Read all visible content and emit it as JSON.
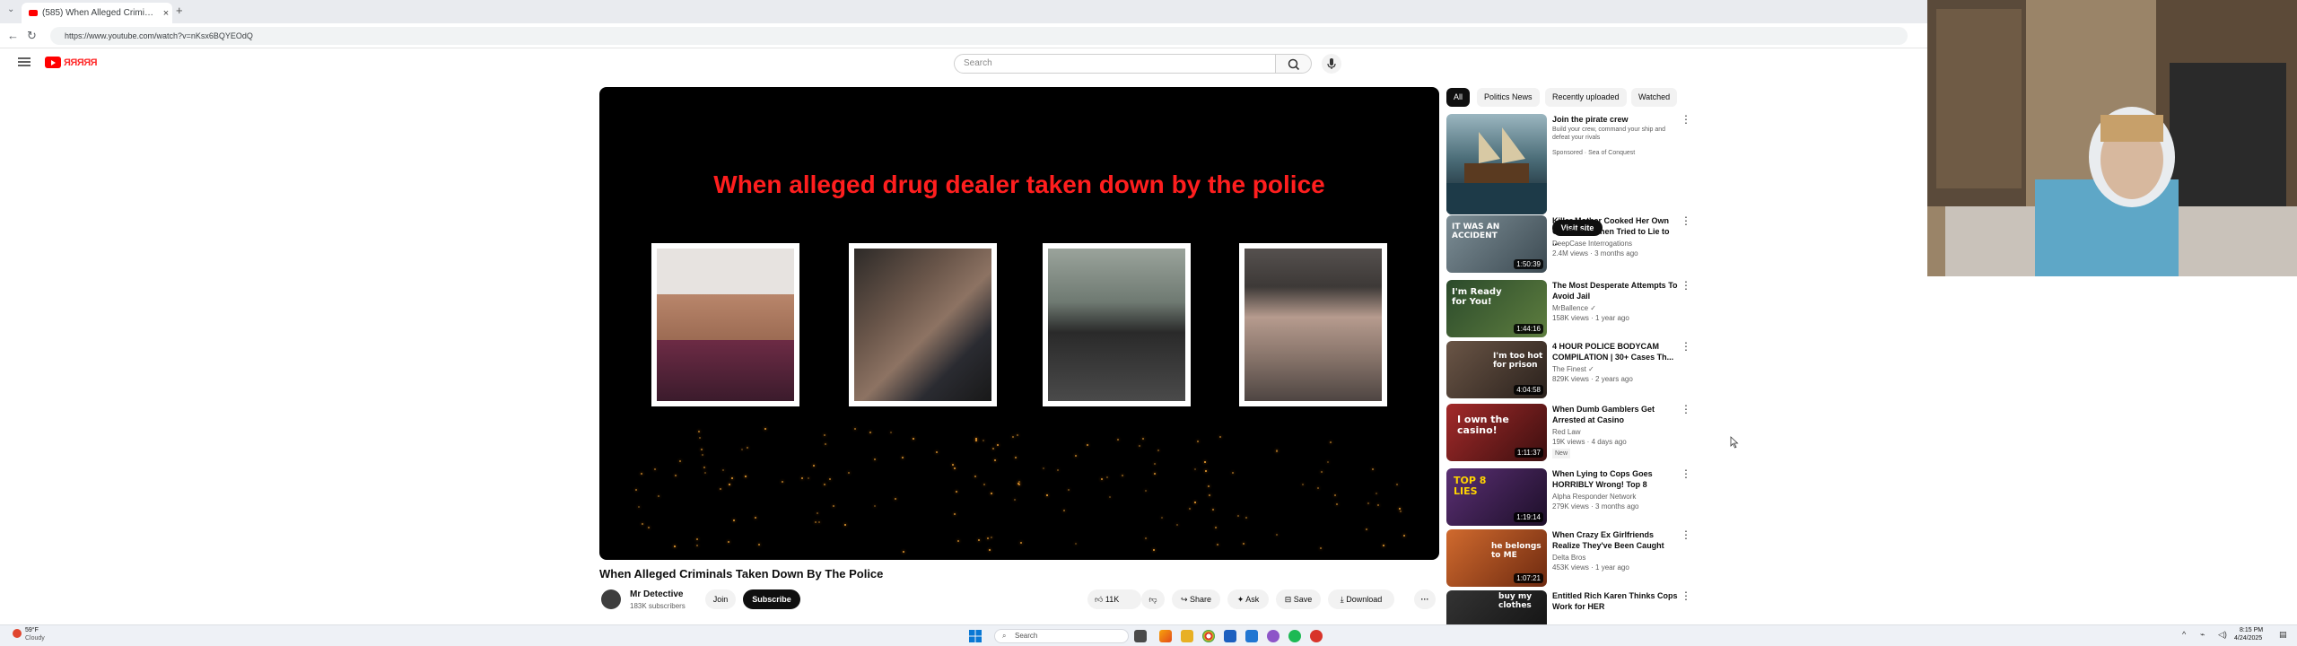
{
  "browser": {
    "tab_title": "(585) When Alleged Criminal...",
    "tab_close": "×",
    "new_tab": "+",
    "url": "https://www.youtube.com/watch?v=nKsx6BQYEOdQ"
  },
  "header": {
    "logo_text": "ЯЯЯЯЯ",
    "search_placeholder": "Search"
  },
  "video": {
    "overlay_title": "When alleged drug dealer taken down by the police",
    "title": "When Alleged Criminals Taken Down By The Police",
    "channel": "Mr Detective",
    "subscribers": "183K subscribers",
    "join_label": "Join",
    "subscribe_label": "Subscribe",
    "likes": "11K",
    "share_label": "Share",
    "ask_label": "Ask",
    "save_label": "Save",
    "download_label": "Download"
  },
  "chips": [
    "All",
    "Politics News",
    "Recently uploaded",
    "Watched"
  ],
  "recommendations": [
    {
      "title": "Join the pirate crew",
      "line1": "Build your crew, command your ship and defeat your rivals",
      "line2": "Sponsored · Sea of Conquest",
      "button": "Visit site",
      "thumb_color": "#3b5a67"
    },
    {
      "title": "Killer Mother Cooked Her Own Children -- Then Tried to Lie to ...",
      "channel": "DeepCase Interrogations",
      "stats": "2.4M views · 3 months ago",
      "duration": "1:50:39",
      "thumb_text": "IT WAS AN ACCIDENT",
      "thumb_color": "#5b6f7a"
    },
    {
      "title": "The Most Desperate Attempts To Avoid Jail",
      "channel": "MrBallence ✓",
      "stats": "158K views · 1 year ago",
      "duration": "1:44:16",
      "thumb_text": "I'm Ready for You!",
      "thumb_color": "#2f4f2f"
    },
    {
      "title": "4 HOUR POLICE BODYCAM COMPILATION | 30+ Cases Th...",
      "channel": "The Finest ✓",
      "stats": "829K views · 2 years ago",
      "duration": "4:04:58",
      "thumb_text": "I'm too hot for prison",
      "thumb_color": "#4a3c33"
    },
    {
      "title": "When Dumb Gamblers Get Arrested at Casino",
      "channel": "Red Law",
      "stats": "19K views · 4 days ago",
      "badge": "New",
      "duration": "1:11:37",
      "thumb_text": "I own the casino!",
      "thumb_color": "#7a1f1f"
    },
    {
      "title": "When Lying to Cops Goes HORRIBLY Wrong! Top 8",
      "channel": "Alpha Responder Network",
      "stats": "279K views · 3 months ago",
      "duration": "1:19:14",
      "thumb_text": "TOP 8 LIES",
      "thumb_color": "#4b2a5e"
    },
    {
      "title": "When Crazy Ex Girlfriends Realize They've Been Caught",
      "channel": "Delta Bros",
      "stats": "453K views · 1 year ago",
      "duration": "1:07:21",
      "thumb_text": "he belongs to ME",
      "thumb_color": "#b04a1d"
    },
    {
      "title": "Entitled Rich Karen Thinks Cops Work for HER",
      "channel": "",
      "stats": "",
      "duration": "",
      "thumb_text": "buy my clothes",
      "thumb_color": "#222"
    }
  ],
  "taskbar": {
    "weather_temp": "59°F",
    "weather_desc": "Cloudy",
    "search_label": "Search",
    "time": "8:15 PM",
    "date": "4/24/2025"
  },
  "colors": {
    "accent_red": "#ff0000",
    "overlay_title": "#ff1e1e"
  }
}
